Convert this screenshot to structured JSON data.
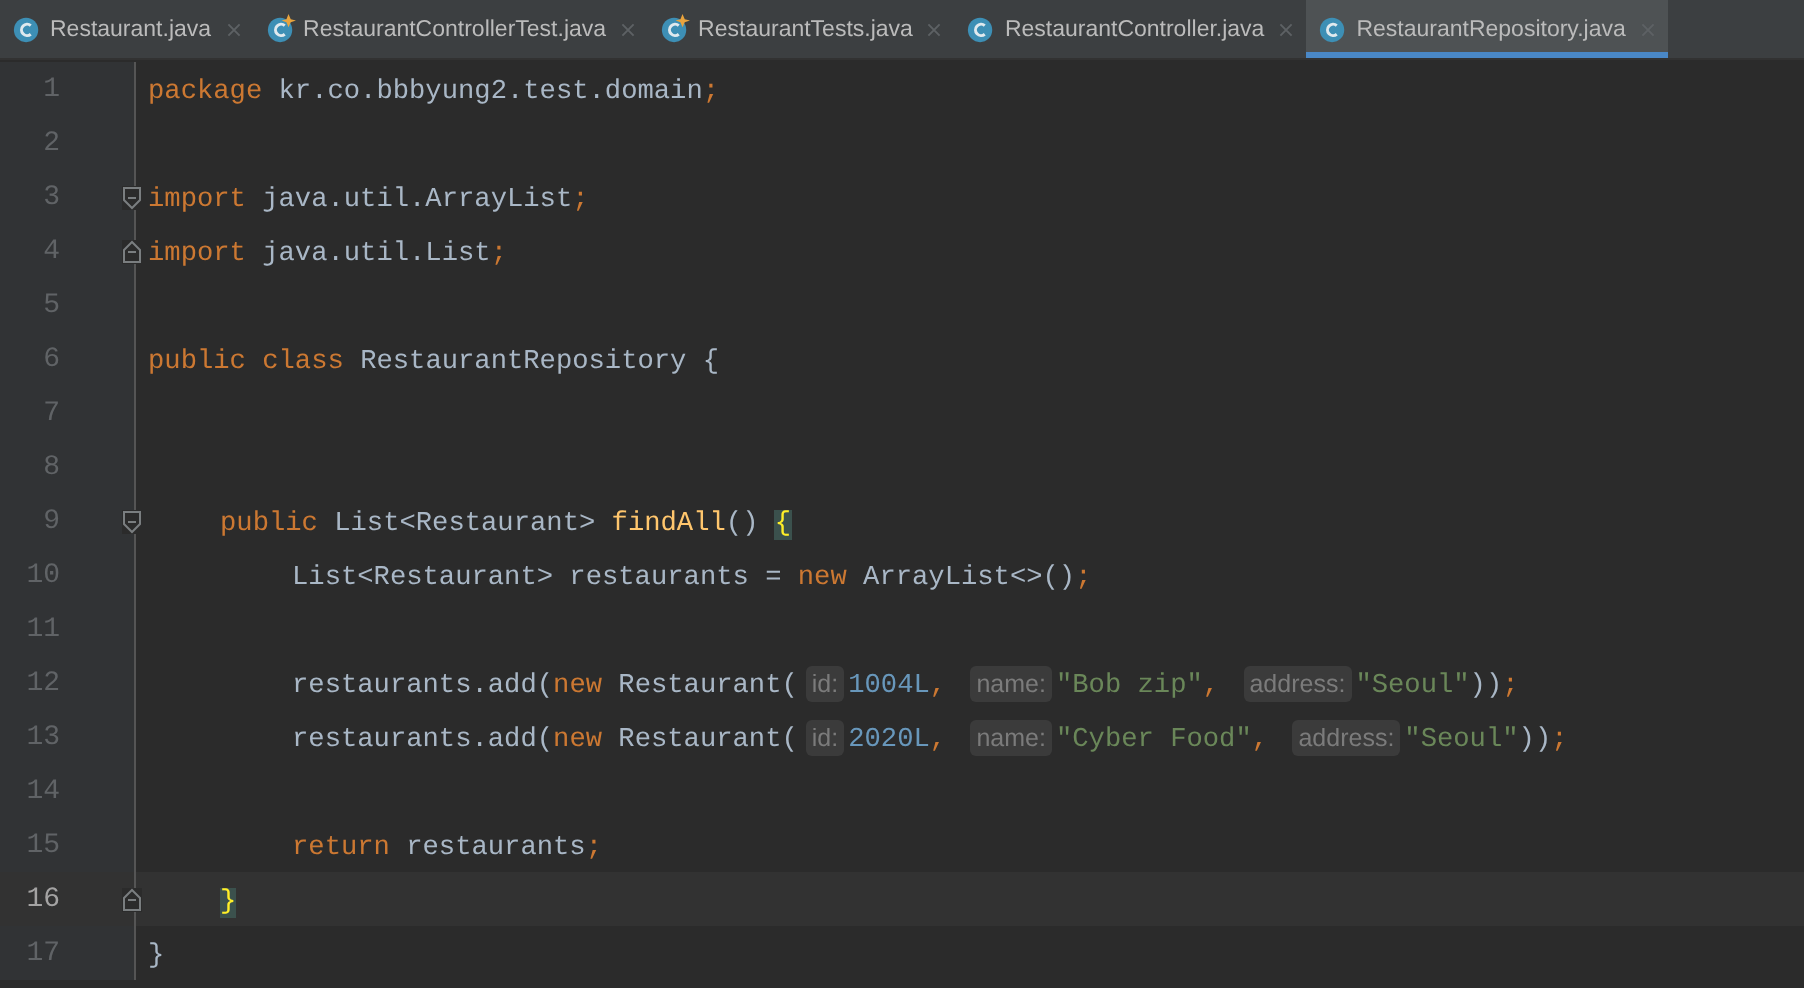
{
  "tabs": [
    {
      "label": "Restaurant.java",
      "kind": "class",
      "selected": false
    },
    {
      "label": "RestaurantControllerTest.java",
      "kind": "test",
      "selected": false
    },
    {
      "label": "RestaurantTests.java",
      "kind": "test",
      "selected": false
    },
    {
      "label": "RestaurantController.java",
      "kind": "class",
      "selected": false
    },
    {
      "label": "RestaurantRepository.java",
      "kind": "class",
      "selected": true
    }
  ],
  "lines": [
    {
      "number": "1",
      "current": false,
      "kind": "top",
      "tokens": [
        {
          "kind": "keyword",
          "text": "package "
        },
        {
          "kind": "plain",
          "text": "kr.co.bbbyung2.test.domain"
        },
        {
          "kind": "keyword",
          "text": ";"
        }
      ]
    },
    {
      "number": "2",
      "current": false
    },
    {
      "number": "3",
      "current": false,
      "fold_start": true,
      "kind": "top",
      "tokens": [
        {
          "kind": "keyword",
          "text": "import "
        },
        {
          "kind": "plain",
          "text": "java.util.ArrayList"
        },
        {
          "kind": "keyword",
          "text": ";"
        }
      ]
    },
    {
      "number": "4",
      "current": false,
      "fold_end": true,
      "kind": "top",
      "tokens": [
        {
          "kind": "keyword",
          "text": "import "
        },
        {
          "kind": "plain",
          "text": "java.util.List"
        },
        {
          "kind": "keyword",
          "text": ";"
        }
      ]
    },
    {
      "number": "5",
      "current": false
    },
    {
      "number": "6",
      "current": false,
      "kind": "top",
      "tokens": [
        {
          "kind": "keyword",
          "text": "public class "
        },
        {
          "kind": "plain",
          "text": "RestaurantRepository {"
        }
      ]
    },
    {
      "number": "7",
      "current": false
    },
    {
      "number": "8",
      "current": false
    },
    {
      "number": "9",
      "current": false,
      "fold_start": true,
      "kind": "member",
      "tokens": [
        {
          "kind": "keyword",
          "text": "public "
        },
        {
          "kind": "plain",
          "text": "List<Restaurant> "
        },
        {
          "kind": "method",
          "text": "findAll"
        },
        {
          "kind": "plain",
          "text": "() "
        },
        {
          "kind": "brace",
          "text": "{"
        }
      ]
    },
    {
      "number": "10",
      "current": false,
      "kind": "body",
      "tokens": [
        {
          "kind": "plain",
          "text": "List<Restaurant> restaurants = "
        },
        {
          "kind": "keyword",
          "text": "new "
        },
        {
          "kind": "plain",
          "text": "ArrayList<>()"
        },
        {
          "kind": "keyword",
          "text": ";"
        }
      ]
    },
    {
      "number": "11",
      "current": false
    },
    {
      "number": "12",
      "current": false,
      "kind": "body",
      "tokens": [
        {
          "kind": "plain",
          "text": "restaurants.add("
        },
        {
          "kind": "keyword",
          "text": "new "
        },
        {
          "kind": "plain",
          "text": "Restaurant("
        },
        {
          "kind": "hint",
          "text": "id:"
        },
        {
          "kind": "number",
          "text": "1004L"
        },
        {
          "kind": "keyword",
          "text": ", "
        },
        {
          "kind": "hint",
          "text": "name:"
        },
        {
          "kind": "string",
          "text": "\"Bob zip\""
        },
        {
          "kind": "keyword",
          "text": ", "
        },
        {
          "kind": "hint",
          "text": "address:"
        },
        {
          "kind": "string",
          "text": "\"Seoul\""
        },
        {
          "kind": "plain",
          "text": "))"
        },
        {
          "kind": "keyword",
          "text": ";"
        }
      ]
    },
    {
      "number": "13",
      "current": false,
      "kind": "body",
      "tokens": [
        {
          "kind": "plain",
          "text": "restaurants.add("
        },
        {
          "kind": "keyword",
          "text": "new "
        },
        {
          "kind": "plain",
          "text": "Restaurant("
        },
        {
          "kind": "hint",
          "text": "id:"
        },
        {
          "kind": "number",
          "text": "2020L"
        },
        {
          "kind": "keyword",
          "text": ", "
        },
        {
          "kind": "hint",
          "text": "name:"
        },
        {
          "kind": "string",
          "text": "\"Cyber Food\""
        },
        {
          "kind": "keyword",
          "text": ", "
        },
        {
          "kind": "hint",
          "text": "address:"
        },
        {
          "kind": "string",
          "text": "\"Seoul\""
        },
        {
          "kind": "plain",
          "text": "))"
        },
        {
          "kind": "keyword",
          "text": ";"
        }
      ]
    },
    {
      "number": "14",
      "current": false
    },
    {
      "number": "15",
      "current": false,
      "kind": "body",
      "tokens": [
        {
          "kind": "keyword",
          "text": "return "
        },
        {
          "kind": "plain",
          "text": "restaurants"
        },
        {
          "kind": "keyword",
          "text": ";"
        }
      ]
    },
    {
      "number": "16",
      "current": true,
      "fold_end": true,
      "kind": "member",
      "tokens": [
        {
          "kind": "brace",
          "text": "}"
        }
      ]
    },
    {
      "number": "17",
      "current": false,
      "kind": "top",
      "tokens": [
        {
          "kind": "plain",
          "text": "}"
        }
      ]
    }
  ]
}
